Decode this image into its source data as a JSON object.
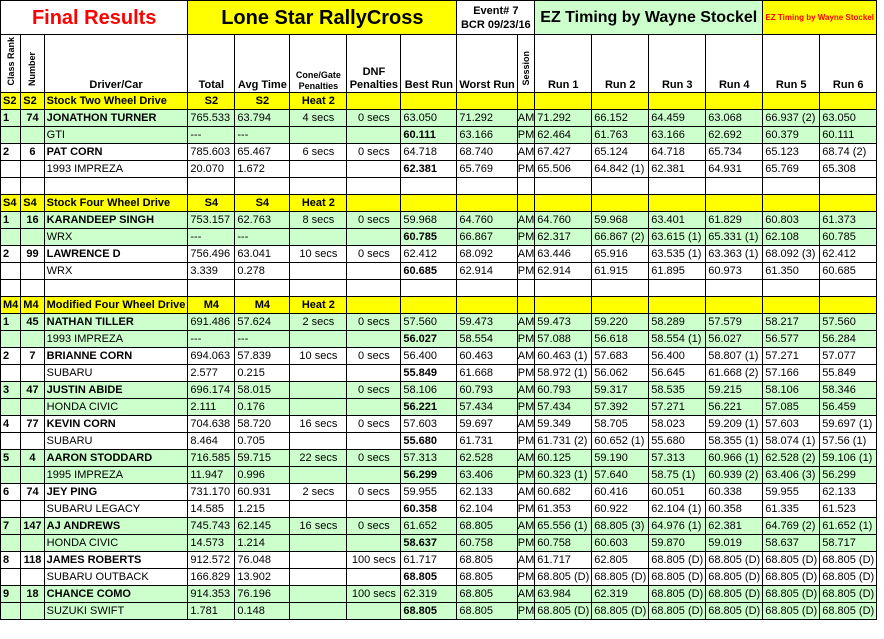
{
  "header": {
    "final_results": "Final Results",
    "event_name": "Lone Star RallyCross",
    "event_no": "Event# 7",
    "event_date": "BCR 09/23/16",
    "ez_timing": "EZ Timing by Wayne Stockel",
    "ez_timing_small": "EZ Timing by Wayne Stockel"
  },
  "columns": {
    "class_rank": "Class Rank",
    "number": "Number",
    "driver_car": "Driver/Car",
    "total": "Total",
    "avg_time": "Avg Time",
    "cone_gate": "Cone/Gate Penalties",
    "dnf": "DNF Penalties",
    "best_run": "Best Run",
    "worst_run": "Worst Run",
    "session": "Session",
    "run1": "Run 1",
    "run2": "Run 2",
    "run3": "Run 3",
    "run4": "Run 4",
    "run5": "Run 5",
    "run6": "Run 6"
  },
  "classes": [
    {
      "code": "S2",
      "code2": "S2",
      "name": "Stock Two Wheel Drive",
      "c1": "S2",
      "c2": "S2",
      "heat": "Heat 2",
      "entries": [
        {
          "rank": "1",
          "num": "74",
          "driver": "JONATHON TURNER",
          "total": "765.533",
          "avg": "63.794",
          "cone": "4 secs",
          "dnf": "0 secs",
          "best": "63.050",
          "worst": "71.292",
          "s1": "AM",
          "r1": [
            "71.292",
            "66.152",
            "64.459",
            "63.068",
            "66.937 (2)",
            "63.050"
          ],
          "car": "GTI",
          "total2": "---",
          "avg2": "---",
          "best2": "60.111",
          "worst2": "63.166",
          "s2": "PM",
          "r2": [
            "62.464",
            "61.763",
            "63.166",
            "62.692",
            "60.379",
            "60.111"
          ],
          "green": true
        },
        {
          "rank": "2",
          "num": "6",
          "driver": "PAT CORN",
          "total": "785.603",
          "avg": "65.467",
          "cone": "6 secs",
          "dnf": "0 secs",
          "best": "64.718",
          "worst": "68.740",
          "s1": "AM",
          "r1": [
            "67.427",
            "65.124",
            "64.718",
            "65.734",
            "65.123",
            "68.74 (2)"
          ],
          "car": "1993 IMPREZA",
          "total2": "20.070",
          "avg2": "1.672",
          "best2": "62.381",
          "worst2": "65.769",
          "s2": "PM",
          "r2": [
            "65.506",
            "64.842 (1)",
            "62.381",
            "64.931",
            "65.769",
            "65.308"
          ],
          "green": false
        }
      ]
    },
    {
      "code": "S4",
      "code2": "S4",
      "name": "Stock Four Wheel Drive",
      "c1": "S4",
      "c2": "S4",
      "heat": "Heat 2",
      "entries": [
        {
          "rank": "1",
          "num": "16",
          "driver": "KARANDEEP SINGH",
          "total": "753.157",
          "avg": "62.763",
          "cone": "8 secs",
          "dnf": "0 secs",
          "best": "59.968",
          "worst": "64.760",
          "s1": "AM",
          "r1": [
            "64.760",
            "59.968",
            "63.401",
            "61.829",
            "60.803",
            "61.373"
          ],
          "car": "WRX",
          "total2": "---",
          "avg2": "---",
          "best2": "60.785",
          "worst2": "66.867",
          "s2": "PM",
          "r2": [
            "62.317",
            "66.867 (2)",
            "63.615 (1)",
            "65.331 (1)",
            "62.108",
            "60.785"
          ],
          "green": true
        },
        {
          "rank": "2",
          "num": "99",
          "driver": "LAWRENCE D",
          "total": "756.496",
          "avg": "63.041",
          "cone": "10 secs",
          "dnf": "0 secs",
          "best": "62.412",
          "worst": "68.092",
          "s1": "AM",
          "r1": [
            "63.446",
            "65.916",
            "63.535 (1)",
            "63.363 (1)",
            "68.092 (3)",
            "62.412"
          ],
          "car": "WRX",
          "total2": "3.339",
          "avg2": "0.278",
          "best2": "60.685",
          "worst2": "62.914",
          "s2": "PM",
          "r2": [
            "62.914",
            "61.915",
            "61.895",
            "60.973",
            "61.350",
            "60.685"
          ],
          "green": false
        }
      ]
    },
    {
      "code": "M4",
      "code2": "M4",
      "name": "Modified Four Wheel Drive",
      "c1": "M4",
      "c2": "M4",
      "heat": "Heat 2",
      "entries": [
        {
          "rank": "1",
          "num": "45",
          "driver": "NATHAN TILLER",
          "total": "691.486",
          "avg": "57.624",
          "cone": "2 secs",
          "dnf": "0 secs",
          "best": "57.560",
          "worst": "59.473",
          "s1": "AM",
          "r1": [
            "59.473",
            "59.220",
            "58.289",
            "57.579",
            "58.217",
            "57.560"
          ],
          "car": "1993 IMPREZA",
          "total2": "---",
          "avg2": "---",
          "best2": "56.027",
          "worst2": "58.554",
          "s2": "PM",
          "r2": [
            "57.088",
            "56.618",
            "58.554 (1)",
            "56.027",
            "56.577",
            "56.284"
          ],
          "green": true
        },
        {
          "rank": "2",
          "num": "7",
          "driver": "BRIANNE CORN",
          "total": "694.063",
          "avg": "57.839",
          "cone": "10 secs",
          "dnf": "0 secs",
          "best": "56.400",
          "worst": "60.463",
          "s1": "AM",
          "r1": [
            "60.463 (1)",
            "57.683",
            "56.400",
            "58.807 (1)",
            "57.271",
            "57.077"
          ],
          "car": "SUBARU",
          "total2": "2.577",
          "avg2": "0.215",
          "best2": "55.849",
          "worst2": "61.668",
          "s2": "PM",
          "r2": [
            "58.972 (1)",
            "56.062",
            "56.645",
            "61.668 (2)",
            "57.166",
            "55.849"
          ],
          "green": false
        },
        {
          "rank": "3",
          "num": "47",
          "driver": "JUSTIN ABIDE",
          "total": "696.174",
          "avg": "58.015",
          "cone": "",
          "dnf": "0 secs",
          "best": "58.106",
          "worst": "60.793",
          "s1": "AM",
          "r1": [
            "60.793",
            "59.317",
            "58.535",
            "59.215",
            "58.106",
            "58.346"
          ],
          "car": "HONDA CIVIC",
          "total2": "2.111",
          "avg2": "0.176",
          "best2": "56.221",
          "worst2": "57.434",
          "s2": "PM",
          "r2": [
            "57.434",
            "57.392",
            "57.271",
            "56.221",
            "57.085",
            "56.459"
          ],
          "green": true
        },
        {
          "rank": "4",
          "num": "77",
          "driver": "KEVIN CORN",
          "total": "704.638",
          "avg": "58.720",
          "cone": "16 secs",
          "dnf": "0 secs",
          "best": "57.603",
          "worst": "59.697",
          "s1": "AM",
          "r1": [
            "59.349",
            "58.705",
            "58.023",
            "59.209 (1)",
            "57.603",
            "59.697 (1)"
          ],
          "car": "SUBARU",
          "total2": "8.464",
          "avg2": "0.705",
          "best2": "55.680",
          "worst2": "61.731",
          "s2": "PM",
          "r2": [
            "61.731 (2)",
            "60.652 (1)",
            "55.680",
            "58.355 (1)",
            "58.074 (1)",
            "57.56 (1)"
          ],
          "green": false
        },
        {
          "rank": "5",
          "num": "4",
          "driver": "AARON STODDARD",
          "total": "716.585",
          "avg": "59.715",
          "cone": "22 secs",
          "dnf": "0 secs",
          "best": "57.313",
          "worst": "62.528",
          "s1": "AM",
          "r1": [
            "60.125",
            "59.190",
            "57.313",
            "60.966 (1)",
            "62.528 (2)",
            "59.106 (1)"
          ],
          "car": "1995 IMPREZA",
          "total2": "11.947",
          "avg2": "0.996",
          "best2": "56.299",
          "worst2": "63.406",
          "s2": "PM",
          "r2": [
            "60.323 (1)",
            "57.640",
            "58.75 (1)",
            "60.939 (2)",
            "63.406 (3)",
            "56.299"
          ],
          "green": true
        },
        {
          "rank": "6",
          "num": "74",
          "driver": "JEY PING",
          "total": "731.170",
          "avg": "60.931",
          "cone": "2 secs",
          "dnf": "0 secs",
          "best": "59.955",
          "worst": "62.133",
          "s1": "AM",
          "r1": [
            "60.682",
            "60.416",
            "60.051",
            "60.338",
            "59.955",
            "62.133"
          ],
          "car": "SUBARU LEGACY",
          "total2": "14.585",
          "avg2": "1.215",
          "best2": "60.358",
          "worst2": "62.104",
          "s2": "PM",
          "r2": [
            "61.353",
            "60.922",
            "62.104 (1)",
            "60.358",
            "61.335",
            "61.523"
          ],
          "green": false
        },
        {
          "rank": "7",
          "num": "147",
          "driver": "AJ ANDREWS",
          "total": "745.743",
          "avg": "62.145",
          "cone": "16 secs",
          "dnf": "0 secs",
          "best": "61.652",
          "worst": "68.805",
          "s1": "AM",
          "r1": [
            "65.556 (1)",
            "68.805 (3)",
            "64.976 (1)",
            "62.381",
            "64.769 (2)",
            "61.652 (1)"
          ],
          "car": "HONDA CIVIC",
          "total2": "14.573",
          "avg2": "1.214",
          "best2": "58.637",
          "worst2": "60.758",
          "s2": "PM",
          "r2": [
            "60.758",
            "60.603",
            "59.870",
            "59.019",
            "58.637",
            "58.717"
          ],
          "green": true
        },
        {
          "rank": "8",
          "num": "118",
          "driver": "JAMES ROBERTS",
          "total": "912.572",
          "avg": "76.048",
          "cone": "",
          "dnf": "100 secs",
          "best": "61.717",
          "worst": "68.805",
          "s1": "AM",
          "r1": [
            "61.717",
            "62.805",
            "68.805 (D)",
            "68.805 (D)",
            "68.805 (D)",
            "68.805 (D)"
          ],
          "car": "SUBARU OUTBACK",
          "total2": "166.829",
          "avg2": "13.902",
          "best2": "68.805",
          "worst2": "68.805",
          "s2": "PM",
          "r2": [
            "68.805 (D)",
            "68.805 (D)",
            "68.805 (D)",
            "68.805 (D)",
            "68.805 (D)",
            "68.805 (D)"
          ],
          "green": false
        },
        {
          "rank": "9",
          "num": "18",
          "driver": "CHANCE COMO",
          "total": "914.353",
          "avg": "76.196",
          "cone": "",
          "dnf": "100 secs",
          "best": "62.319",
          "worst": "68.805",
          "s1": "AM",
          "r1": [
            "63.984",
            "62.319",
            "68.805 (D)",
            "68.805 (D)",
            "68.805 (D)",
            "68.805 (D)"
          ],
          "car": "SUZUKI SWIFT",
          "total2": "1.781",
          "avg2": "0.148",
          "best2": "68.805",
          "worst2": "68.805",
          "s2": "PM",
          "r2": [
            "68.805 (D)",
            "68.805 (D)",
            "68.805 (D)",
            "68.805 (D)",
            "68.805 (D)",
            "68.805 (D)"
          ],
          "green": true
        }
      ]
    }
  ],
  "colors": {
    "class_yellow": "#ffff00",
    "green_row": "#ccffcc",
    "title_red": "#ff0000"
  }
}
